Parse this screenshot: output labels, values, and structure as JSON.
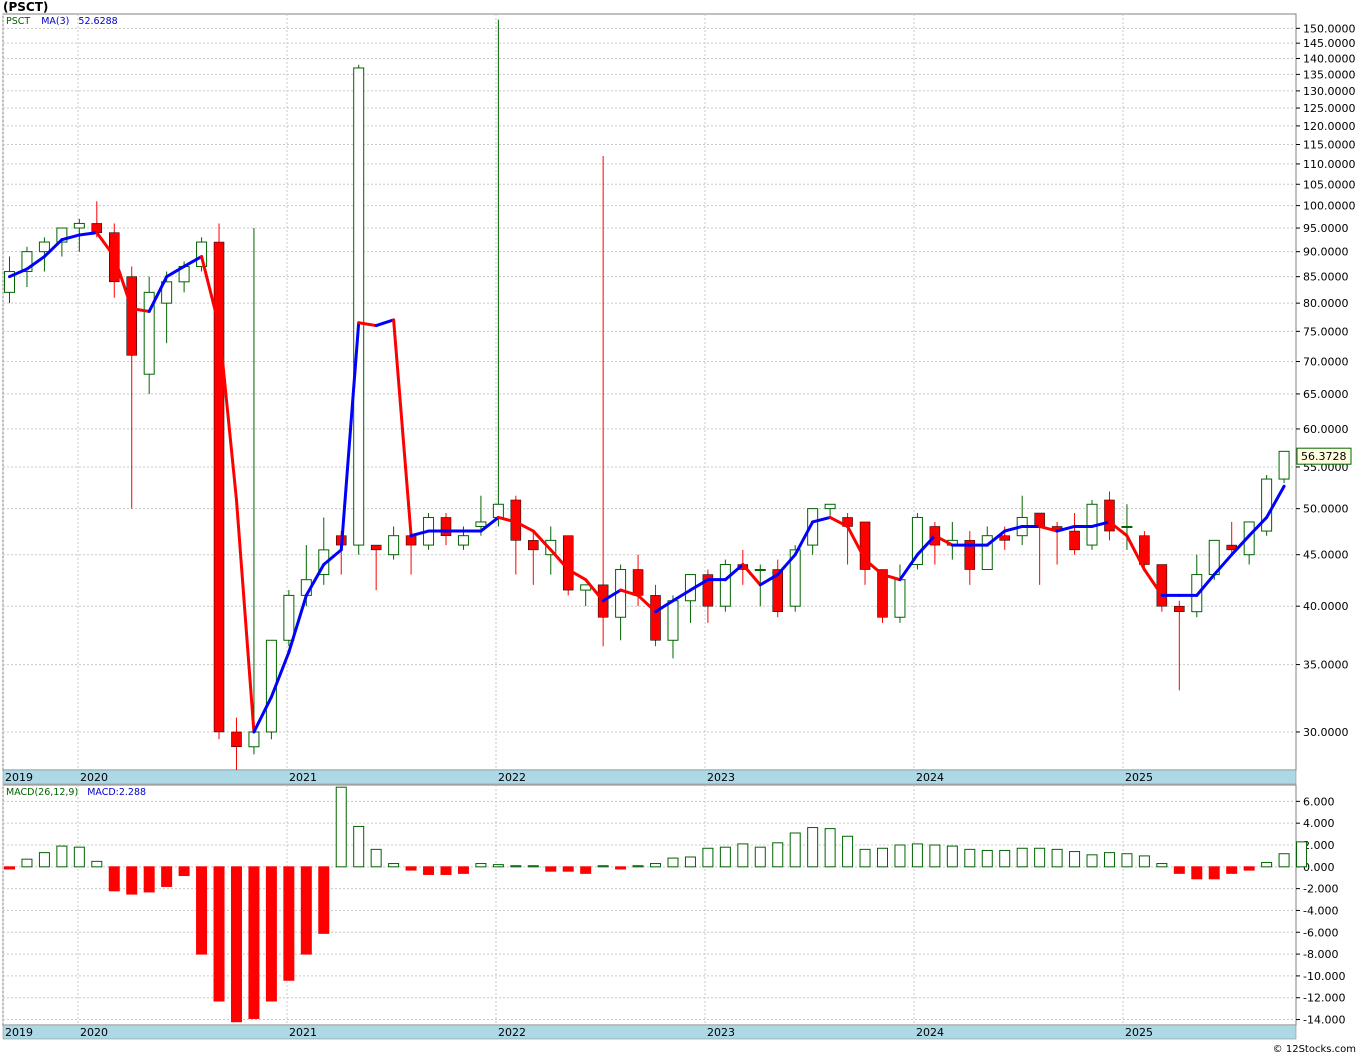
{
  "title": "(PSCT)",
  "footer": "© 12Stocks.com",
  "price_legend": {
    "symbol": "PSCT",
    "indicator": "MA(3)",
    "value": "52.6288"
  },
  "macd_legend": {
    "indicator": "MACD(26,12,9)",
    "value": "MACD:2.288"
  },
  "last_price_label": "56.3728",
  "colors": {
    "up": "#006400",
    "down": "#ff0000",
    "ma_up": "#0000ff",
    "ma_down": "#ff0000",
    "timeline": "#add8e6"
  },
  "chart_data": [
    {
      "type": "candlestick",
      "title": "(PSCT)",
      "y_scale": "log",
      "ylim": [
        27.5,
        155
      ],
      "x_labels": [
        "2019",
        "2020",
        "2021",
        "2022",
        "2023",
        "2024",
        "2025"
      ],
      "y_ticks": [
        "150.0000",
        "145.0000",
        "140.0000",
        "135.0000",
        "130.0000",
        "125.0000",
        "120.0000",
        "115.0000",
        "110.0000",
        "105.0000",
        "100.0000",
        "95.0000",
        "90.0000",
        "85.0000",
        "80.0000",
        "75.0000",
        "70.0000",
        "65.0000",
        "60.0000",
        "55.0000",
        "50.0000",
        "45.0000",
        "40.0000",
        "35.0000",
        "30.0000"
      ],
      "candles": [
        [
          82,
          89,
          80,
          86
        ],
        [
          86,
          91,
          83,
          90
        ],
        [
          90,
          93,
          86,
          92
        ],
        [
          92,
          94,
          89,
          95
        ],
        [
          95,
          97,
          90,
          96
        ],
        [
          96,
          101,
          93,
          94
        ],
        [
          94,
          96,
          81,
          84
        ],
        [
          85,
          87,
          50,
          71
        ],
        [
          68,
          85,
          65,
          82
        ],
        [
          80,
          86,
          73,
          84
        ],
        [
          84,
          88,
          82,
          87
        ],
        [
          87,
          93,
          86,
          92
        ],
        [
          92,
          96,
          29.5,
          30
        ],
        [
          30,
          31,
          27.5,
          29
        ],
        [
          29,
          95,
          28.5,
          30
        ],
        [
          30,
          37,
          29.5,
          37
        ],
        [
          37,
          41.5,
          36.5,
          41
        ],
        [
          41,
          46,
          40,
          42.5
        ],
        [
          43,
          49,
          42,
          45.5
        ],
        [
          47,
          47.5,
          43,
          46
        ],
        [
          46,
          138,
          45,
          137
        ],
        [
          46,
          46,
          41.5,
          45.5
        ],
        [
          45,
          48,
          44.5,
          47
        ],
        [
          47,
          48,
          43,
          46
        ],
        [
          46,
          49.5,
          45.5,
          49
        ],
        [
          49,
          49.5,
          46,
          47
        ],
        [
          46,
          48,
          45.5,
          47
        ],
        [
          48,
          51.5,
          47,
          48.5
        ],
        [
          49,
          153,
          48,
          50.5
        ],
        [
          51,
          51.5,
          43,
          46.5
        ],
        [
          46.5,
          47.5,
          42,
          45.5
        ],
        [
          45,
          48,
          43,
          46.5
        ],
        [
          47,
          47,
          41,
          41.5
        ],
        [
          41.5,
          42,
          40,
          42
        ],
        [
          42,
          112,
          36.5,
          39
        ],
        [
          39,
          44,
          37,
          43.5
        ],
        [
          43.5,
          45,
          40,
          41
        ],
        [
          41,
          42,
          36.5,
          37
        ],
        [
          37,
          41,
          35.5,
          40.5
        ],
        [
          40.5,
          43,
          38.5,
          43
        ],
        [
          43,
          43.5,
          38.5,
          40
        ],
        [
          40,
          44.5,
          39.5,
          44
        ],
        [
          44,
          45.5,
          42,
          43.5
        ],
        [
          43.5,
          44,
          40,
          43.5
        ],
        [
          43.5,
          44.5,
          39,
          39.5
        ],
        [
          40,
          46,
          39.5,
          45.5
        ],
        [
          46,
          50,
          45,
          50
        ],
        [
          50,
          50.5,
          49,
          50.5
        ],
        [
          49,
          49.5,
          44,
          48
        ],
        [
          48.5,
          48.5,
          42,
          43.5
        ],
        [
          43.5,
          43.5,
          38.5,
          39
        ],
        [
          39,
          44,
          38.5,
          42.5
        ],
        [
          44,
          49.5,
          43.5,
          49
        ],
        [
          48,
          48.5,
          44,
          46
        ],
        [
          46,
          48.5,
          44.5,
          46.5
        ],
        [
          46.5,
          47.5,
          42,
          43.5
        ],
        [
          43.5,
          48,
          43.5,
          47
        ],
        [
          47,
          48,
          45.5,
          46.5
        ],
        [
          47,
          51.5,
          46,
          49
        ],
        [
          49.5,
          49.5,
          42,
          48
        ],
        [
          48,
          48.5,
          44,
          47.5
        ],
        [
          47.5,
          49.5,
          45,
          45.5
        ],
        [
          46,
          51,
          45.5,
          50.5
        ],
        [
          51,
          52,
          46.5,
          47.5
        ],
        [
          48,
          50.5,
          45.5,
          48
        ],
        [
          47,
          47.5,
          43.5,
          44
        ],
        [
          44,
          44,
          39.5,
          40
        ],
        [
          40,
          40.5,
          33,
          39.5
        ],
        [
          39.5,
          45,
          39,
          43
        ],
        [
          43,
          46.5,
          42.5,
          46.5
        ],
        [
          46,
          48.5,
          45,
          45.5
        ],
        [
          45,
          48.5,
          44,
          48.5
        ],
        [
          47.5,
          54,
          47,
          53.5
        ],
        [
          53.5,
          57,
          53,
          57
        ]
      ],
      "ma_values": [
        85,
        86.5,
        89,
        92.5,
        93.5,
        94,
        89,
        79,
        78.5,
        85,
        87,
        89,
        76,
        51,
        30,
        32.5,
        36,
        41,
        44,
        45.5,
        76.5,
        76,
        77,
        47,
        47.5,
        47.5,
        47.5,
        47.5,
        49,
        48.5,
        47.5,
        45.5,
        43.5,
        42.5,
        40.5,
        41.5,
        41,
        39.5,
        40.5,
        41.5,
        42.5,
        42.5,
        44,
        42,
        43,
        45,
        48.5,
        49,
        48,
        44.5,
        43,
        42.5,
        45,
        47,
        46,
        46,
        46,
        47.5,
        48,
        48,
        47.5,
        48,
        48,
        48.5,
        47,
        43.5,
        41,
        41,
        41,
        43,
        45,
        47,
        49,
        52.6288
      ],
      "last_value": 56.3728
    },
    {
      "type": "bar",
      "title": "MACD(26,12,9)",
      "ylim": [
        -14.5,
        7.5
      ],
      "y_ticks": [
        "6.000",
        "4.000",
        "2.000",
        "0.000",
        "-2.000",
        "-4.000",
        "-6.000",
        "-8.000",
        "-10.000",
        "-12.000",
        "-14.000"
      ],
      "values": [
        -0.2,
        0.7,
        1.3,
        1.9,
        1.8,
        0.5,
        -2.2,
        -2.5,
        -2.3,
        -1.8,
        -0.8,
        -8,
        -12.3,
        -14.2,
        -13.9,
        -12.3,
        -10.4,
        -8,
        -6.1,
        7.3,
        3.7,
        1.6,
        0.3,
        -0.3,
        -0.7,
        -0.7,
        -0.6,
        0.3,
        0.2,
        0.1,
        0.1,
        -0.4,
        -0.4,
        -0.6,
        0.1,
        -0.2,
        0.1,
        0.3,
        0.8,
        0.9,
        1.7,
        1.8,
        2.1,
        1.8,
        2.2,
        3.1,
        3.6,
        3.5,
        2.8,
        1.6,
        1.7,
        2,
        2.1,
        2,
        1.9,
        1.6,
        1.5,
        1.5,
        1.7,
        1.7,
        1.6,
        1.4,
        1.1,
        1.3,
        1.2,
        1,
        0.3,
        -0.6,
        -1.1,
        -1.1,
        -0.6,
        -0.3,
        0.4,
        1.2,
        2.288
      ]
    }
  ]
}
